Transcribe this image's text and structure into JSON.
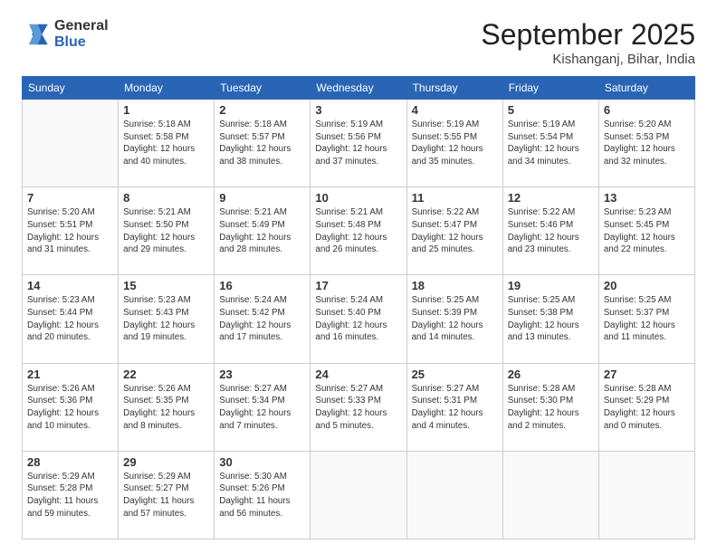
{
  "header": {
    "logo_line1": "General",
    "logo_line2": "Blue",
    "month": "September 2025",
    "location": "Kishanganj, Bihar, India"
  },
  "weekdays": [
    "Sunday",
    "Monday",
    "Tuesday",
    "Wednesday",
    "Thursday",
    "Friday",
    "Saturday"
  ],
  "weeks": [
    [
      {
        "day": "",
        "info": ""
      },
      {
        "day": "1",
        "info": "Sunrise: 5:18 AM\nSunset: 5:58 PM\nDaylight: 12 hours\nand 40 minutes."
      },
      {
        "day": "2",
        "info": "Sunrise: 5:18 AM\nSunset: 5:57 PM\nDaylight: 12 hours\nand 38 minutes."
      },
      {
        "day": "3",
        "info": "Sunrise: 5:19 AM\nSunset: 5:56 PM\nDaylight: 12 hours\nand 37 minutes."
      },
      {
        "day": "4",
        "info": "Sunrise: 5:19 AM\nSunset: 5:55 PM\nDaylight: 12 hours\nand 35 minutes."
      },
      {
        "day": "5",
        "info": "Sunrise: 5:19 AM\nSunset: 5:54 PM\nDaylight: 12 hours\nand 34 minutes."
      },
      {
        "day": "6",
        "info": "Sunrise: 5:20 AM\nSunset: 5:53 PM\nDaylight: 12 hours\nand 32 minutes."
      }
    ],
    [
      {
        "day": "7",
        "info": "Sunrise: 5:20 AM\nSunset: 5:51 PM\nDaylight: 12 hours\nand 31 minutes."
      },
      {
        "day": "8",
        "info": "Sunrise: 5:21 AM\nSunset: 5:50 PM\nDaylight: 12 hours\nand 29 minutes."
      },
      {
        "day": "9",
        "info": "Sunrise: 5:21 AM\nSunset: 5:49 PM\nDaylight: 12 hours\nand 28 minutes."
      },
      {
        "day": "10",
        "info": "Sunrise: 5:21 AM\nSunset: 5:48 PM\nDaylight: 12 hours\nand 26 minutes."
      },
      {
        "day": "11",
        "info": "Sunrise: 5:22 AM\nSunset: 5:47 PM\nDaylight: 12 hours\nand 25 minutes."
      },
      {
        "day": "12",
        "info": "Sunrise: 5:22 AM\nSunset: 5:46 PM\nDaylight: 12 hours\nand 23 minutes."
      },
      {
        "day": "13",
        "info": "Sunrise: 5:23 AM\nSunset: 5:45 PM\nDaylight: 12 hours\nand 22 minutes."
      }
    ],
    [
      {
        "day": "14",
        "info": "Sunrise: 5:23 AM\nSunset: 5:44 PM\nDaylight: 12 hours\nand 20 minutes."
      },
      {
        "day": "15",
        "info": "Sunrise: 5:23 AM\nSunset: 5:43 PM\nDaylight: 12 hours\nand 19 minutes."
      },
      {
        "day": "16",
        "info": "Sunrise: 5:24 AM\nSunset: 5:42 PM\nDaylight: 12 hours\nand 17 minutes."
      },
      {
        "day": "17",
        "info": "Sunrise: 5:24 AM\nSunset: 5:40 PM\nDaylight: 12 hours\nand 16 minutes."
      },
      {
        "day": "18",
        "info": "Sunrise: 5:25 AM\nSunset: 5:39 PM\nDaylight: 12 hours\nand 14 minutes."
      },
      {
        "day": "19",
        "info": "Sunrise: 5:25 AM\nSunset: 5:38 PM\nDaylight: 12 hours\nand 13 minutes."
      },
      {
        "day": "20",
        "info": "Sunrise: 5:25 AM\nSunset: 5:37 PM\nDaylight: 12 hours\nand 11 minutes."
      }
    ],
    [
      {
        "day": "21",
        "info": "Sunrise: 5:26 AM\nSunset: 5:36 PM\nDaylight: 12 hours\nand 10 minutes."
      },
      {
        "day": "22",
        "info": "Sunrise: 5:26 AM\nSunset: 5:35 PM\nDaylight: 12 hours\nand 8 minutes."
      },
      {
        "day": "23",
        "info": "Sunrise: 5:27 AM\nSunset: 5:34 PM\nDaylight: 12 hours\nand 7 minutes."
      },
      {
        "day": "24",
        "info": "Sunrise: 5:27 AM\nSunset: 5:33 PM\nDaylight: 12 hours\nand 5 minutes."
      },
      {
        "day": "25",
        "info": "Sunrise: 5:27 AM\nSunset: 5:31 PM\nDaylight: 12 hours\nand 4 minutes."
      },
      {
        "day": "26",
        "info": "Sunrise: 5:28 AM\nSunset: 5:30 PM\nDaylight: 12 hours\nand 2 minutes."
      },
      {
        "day": "27",
        "info": "Sunrise: 5:28 AM\nSunset: 5:29 PM\nDaylight: 12 hours\nand 0 minutes."
      }
    ],
    [
      {
        "day": "28",
        "info": "Sunrise: 5:29 AM\nSunset: 5:28 PM\nDaylight: 11 hours\nand 59 minutes."
      },
      {
        "day": "29",
        "info": "Sunrise: 5:29 AM\nSunset: 5:27 PM\nDaylight: 11 hours\nand 57 minutes."
      },
      {
        "day": "30",
        "info": "Sunrise: 5:30 AM\nSunset: 5:26 PM\nDaylight: 11 hours\nand 56 minutes."
      },
      {
        "day": "",
        "info": ""
      },
      {
        "day": "",
        "info": ""
      },
      {
        "day": "",
        "info": ""
      },
      {
        "day": "",
        "info": ""
      }
    ]
  ]
}
